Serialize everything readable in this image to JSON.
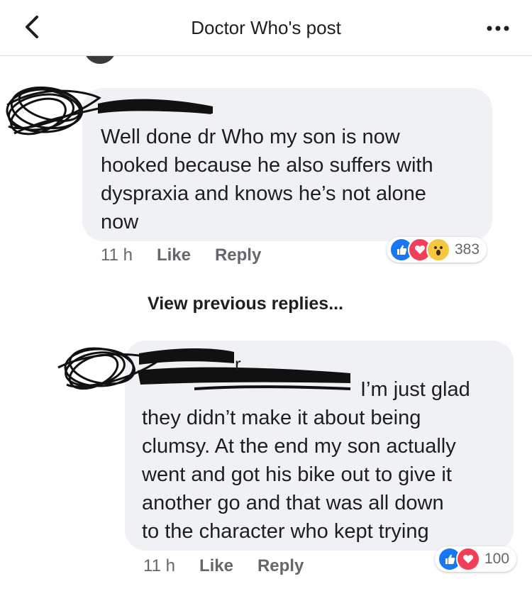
{
  "header": {
    "title": "Doctor Who's post",
    "back_icon": "chevron-left-icon",
    "more_icon": "more-dots-icon"
  },
  "comments": [
    {
      "text": "Well done dr Who my son is now\nhooked because he also suffers with\ndyspraxia and knows he’s not alone\nnow",
      "timestamp": "11 h",
      "like_label": "Like",
      "reply_label": "Reply",
      "reactions": [
        "like",
        "love",
        "wow"
      ],
      "reaction_count": "383"
    },
    {
      "name_fragment": "r",
      "text": "I’m just glad\nthey didn’t make it about being\nclumsy. At the end my son actually\nwent and got his bike out to give it\nanother go and that was all down\nto the character who kept trying",
      "timestamp": "11 h",
      "like_label": "Like",
      "reply_label": "Reply",
      "reactions": [
        "like",
        "love"
      ],
      "reaction_count": "100"
    }
  ],
  "view_previous_replies": "View previous replies...",
  "colors": {
    "bubble": "#f0f1f4",
    "like": "#1877f2",
    "love": "#f33e58",
    "wow": "#f7c83f",
    "meta_text": "#65676b"
  }
}
